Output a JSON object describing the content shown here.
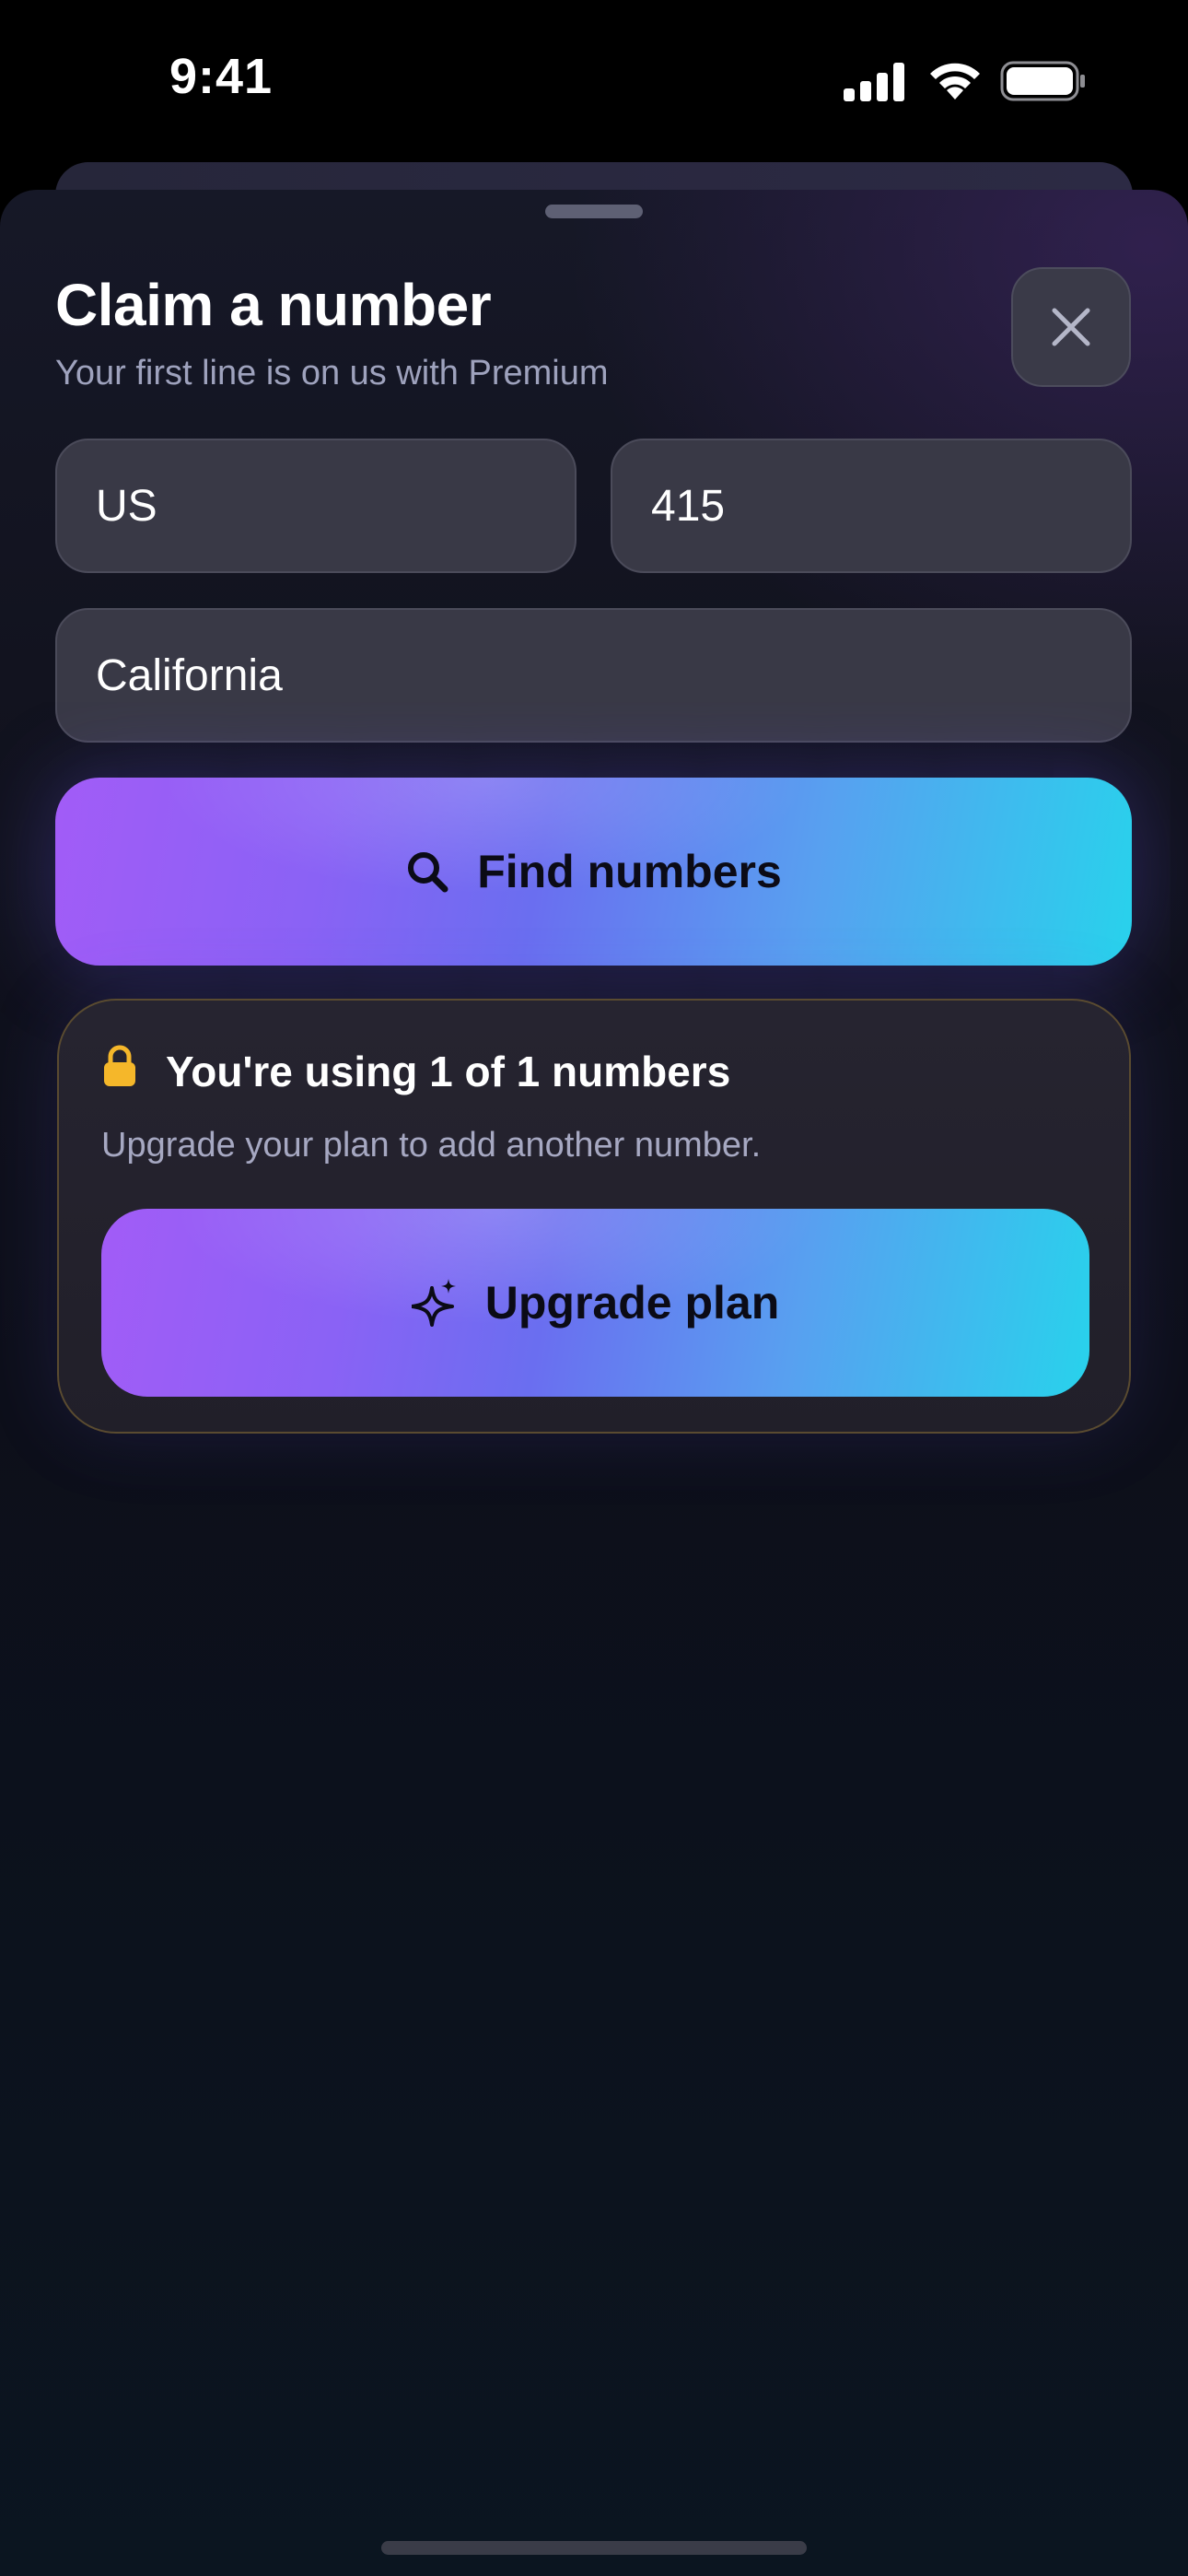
{
  "status_bar": {
    "time": "9:41",
    "icons": [
      "cellular-signal-icon",
      "wifi-icon",
      "battery-icon"
    ]
  },
  "sheet": {
    "title": "Claim a number",
    "subtitle": "Your first line is on us with Premium",
    "close_icon": "close-icon"
  },
  "form": {
    "country": "US",
    "area_code": "415",
    "region": "California",
    "find_button": {
      "label": "Find numbers",
      "icon": "search-icon"
    }
  },
  "limit_card": {
    "icon": "lock-icon",
    "title": "You're using 1 of 1 numbers",
    "description": "Upgrade your plan to add another number.",
    "upgrade_button": {
      "label": "Upgrade plan",
      "icon": "sparkles-icon"
    }
  },
  "colors": {
    "accent_start": "#a25cf7",
    "accent_mid": "#6a6ef0",
    "accent_end": "#28d2ec",
    "lock": "#f5b72a"
  }
}
